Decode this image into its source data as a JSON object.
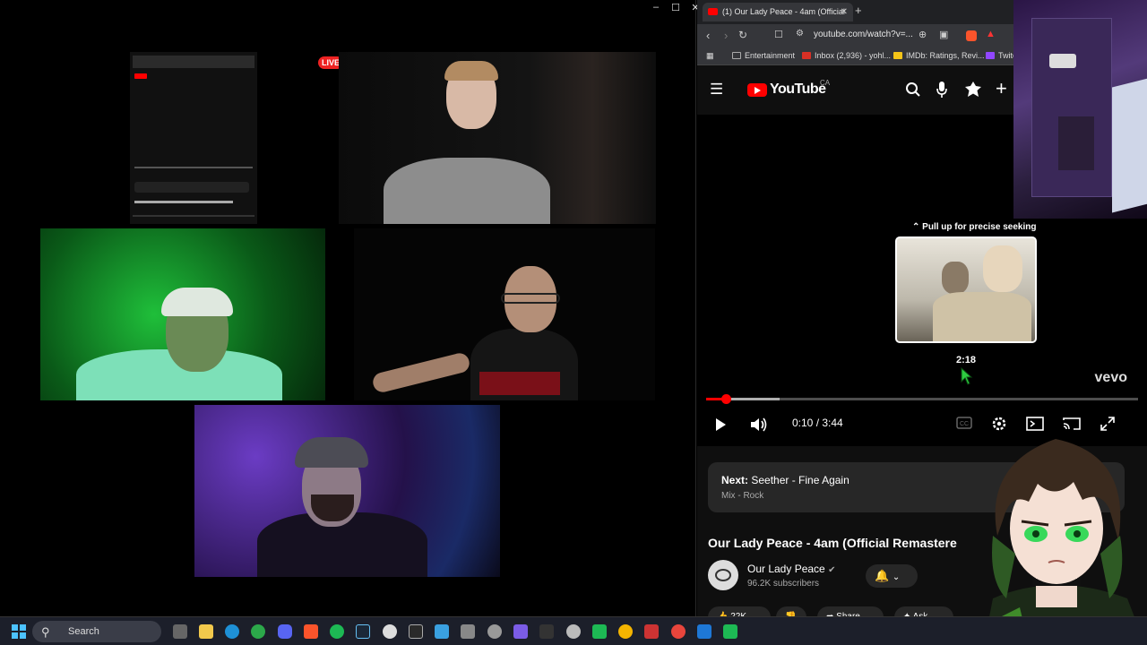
{
  "call_window": {
    "controls": [
      "–",
      "☐",
      "✕"
    ],
    "live_badge": "LIVE"
  },
  "browser": {
    "tab_title": "(1) Our Lady Peace - 4am (Official",
    "tab_close": "✕",
    "new_tab": "+",
    "url": "youtube.com/watch?v=...",
    "bookmarks": [
      "Entertainment",
      "Inbox (2,936) - yohl...",
      "IMDb: Ratings, Revi...",
      "Twitc"
    ],
    "bookmark_colors": [
      "#aaaaaa",
      "#d93025",
      "#f5c518",
      "#9146ff"
    ]
  },
  "youtube": {
    "logo_text": "YouTube",
    "country": "CA",
    "player": {
      "seek_hint": "Pull up for precise seeking",
      "preview_time": "2:18",
      "watermark": "vevo",
      "current_time": "0:10",
      "duration": "3:44",
      "timecode": "0:10 / 3:44",
      "progress_fraction": 0.045,
      "buffered_fraction": 0.17,
      "hover_fraction": 0.6
    },
    "next": {
      "label": "Next:",
      "title": "Seether - Fine Again",
      "subtitle": "Mix - Rock"
    },
    "video_title": "Our Lady Peace - 4am (Official Remastere",
    "channel": {
      "name": "Our Lady Peace",
      "subscribers": "96.2K subscribers"
    },
    "actions": [
      "22K",
      "",
      "Share",
      "Ask"
    ]
  },
  "taskbar": {
    "search_label": "Search"
  },
  "colors": {
    "accent_red": "#ff0000",
    "player_bg": "#000000",
    "card_bg": "#272727"
  }
}
